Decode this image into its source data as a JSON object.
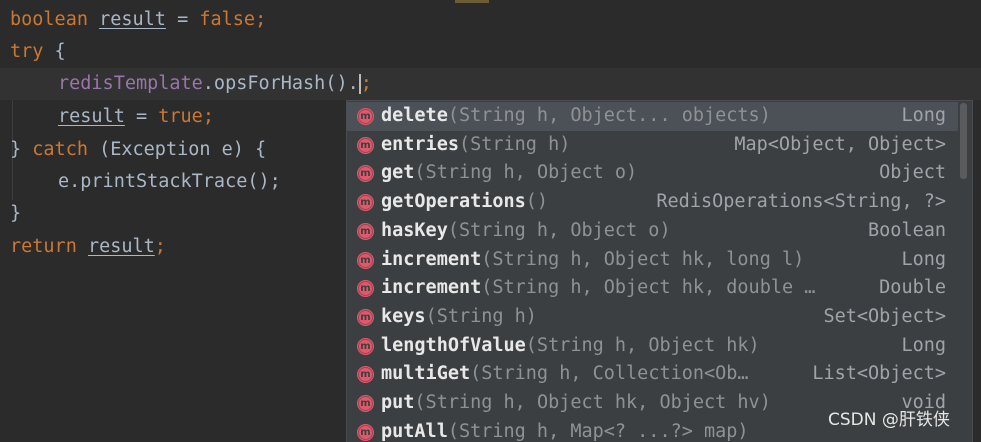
{
  "code": {
    "line1": {
      "kw": "boolean",
      "var": "result",
      "eq": " = ",
      "val": "false",
      "end": ";"
    },
    "line2": {
      "kw": "try",
      "rest": " {"
    },
    "line3": {
      "obj": "redisTemplate",
      "call": ".opsForHash().",
      "end": ";"
    },
    "line4": {
      "var": "result",
      "eq": " = ",
      "val": "true",
      "end": ";"
    },
    "line5": {
      "brace": "} ",
      "kw": "catch",
      "rest": " (Exception e) {"
    },
    "line6": {
      "text": "e.printStackTrace();"
    },
    "line7": {
      "text": "}"
    },
    "line8": {
      "kw": "return",
      "sp": " ",
      "var": "result",
      "end": ";"
    }
  },
  "completion": {
    "items": [
      {
        "name": "delete",
        "params": "(String h, Object... objects)",
        "type": "Long"
      },
      {
        "name": "entries",
        "params": "(String h)",
        "type": "Map<Object, Object>"
      },
      {
        "name": "get",
        "params": "(String h, Object o)",
        "type": "Object"
      },
      {
        "name": "getOperations",
        "params": "()",
        "type": "RedisOperations<String, ?>"
      },
      {
        "name": "hasKey",
        "params": "(String h, Object o)",
        "type": "Boolean"
      },
      {
        "name": "increment",
        "params": "(String h, Object hk, long l)",
        "type": "Long"
      },
      {
        "name": "increment",
        "params": "(String h, Object hk, double …",
        "type": "Double"
      },
      {
        "name": "keys",
        "params": "(String h)",
        "type": "Set<Object>"
      },
      {
        "name": "lengthOfValue",
        "params": "(String h, Object hk)",
        "type": "Long"
      },
      {
        "name": "multiGet",
        "params": "(String h, Collection<Ob…",
        "type": "List<Object>"
      },
      {
        "name": "put",
        "params": "(String h, Object hk, Object hv)",
        "type": "void"
      },
      {
        "name": "putAll",
        "params": "(String h, Map<? ...?> map)",
        "type": ""
      }
    ],
    "icon_letter": "m",
    "icon_color": "#e3576b",
    "selected_color": "#4b5157"
  },
  "watermark": "CSDN @肝铁侠",
  "colors": {
    "background": "#2b2b2b",
    "keyword": "#cc7832",
    "field": "#9876aa",
    "text": "#a9b7c6",
    "popup": "#3c3f41"
  }
}
